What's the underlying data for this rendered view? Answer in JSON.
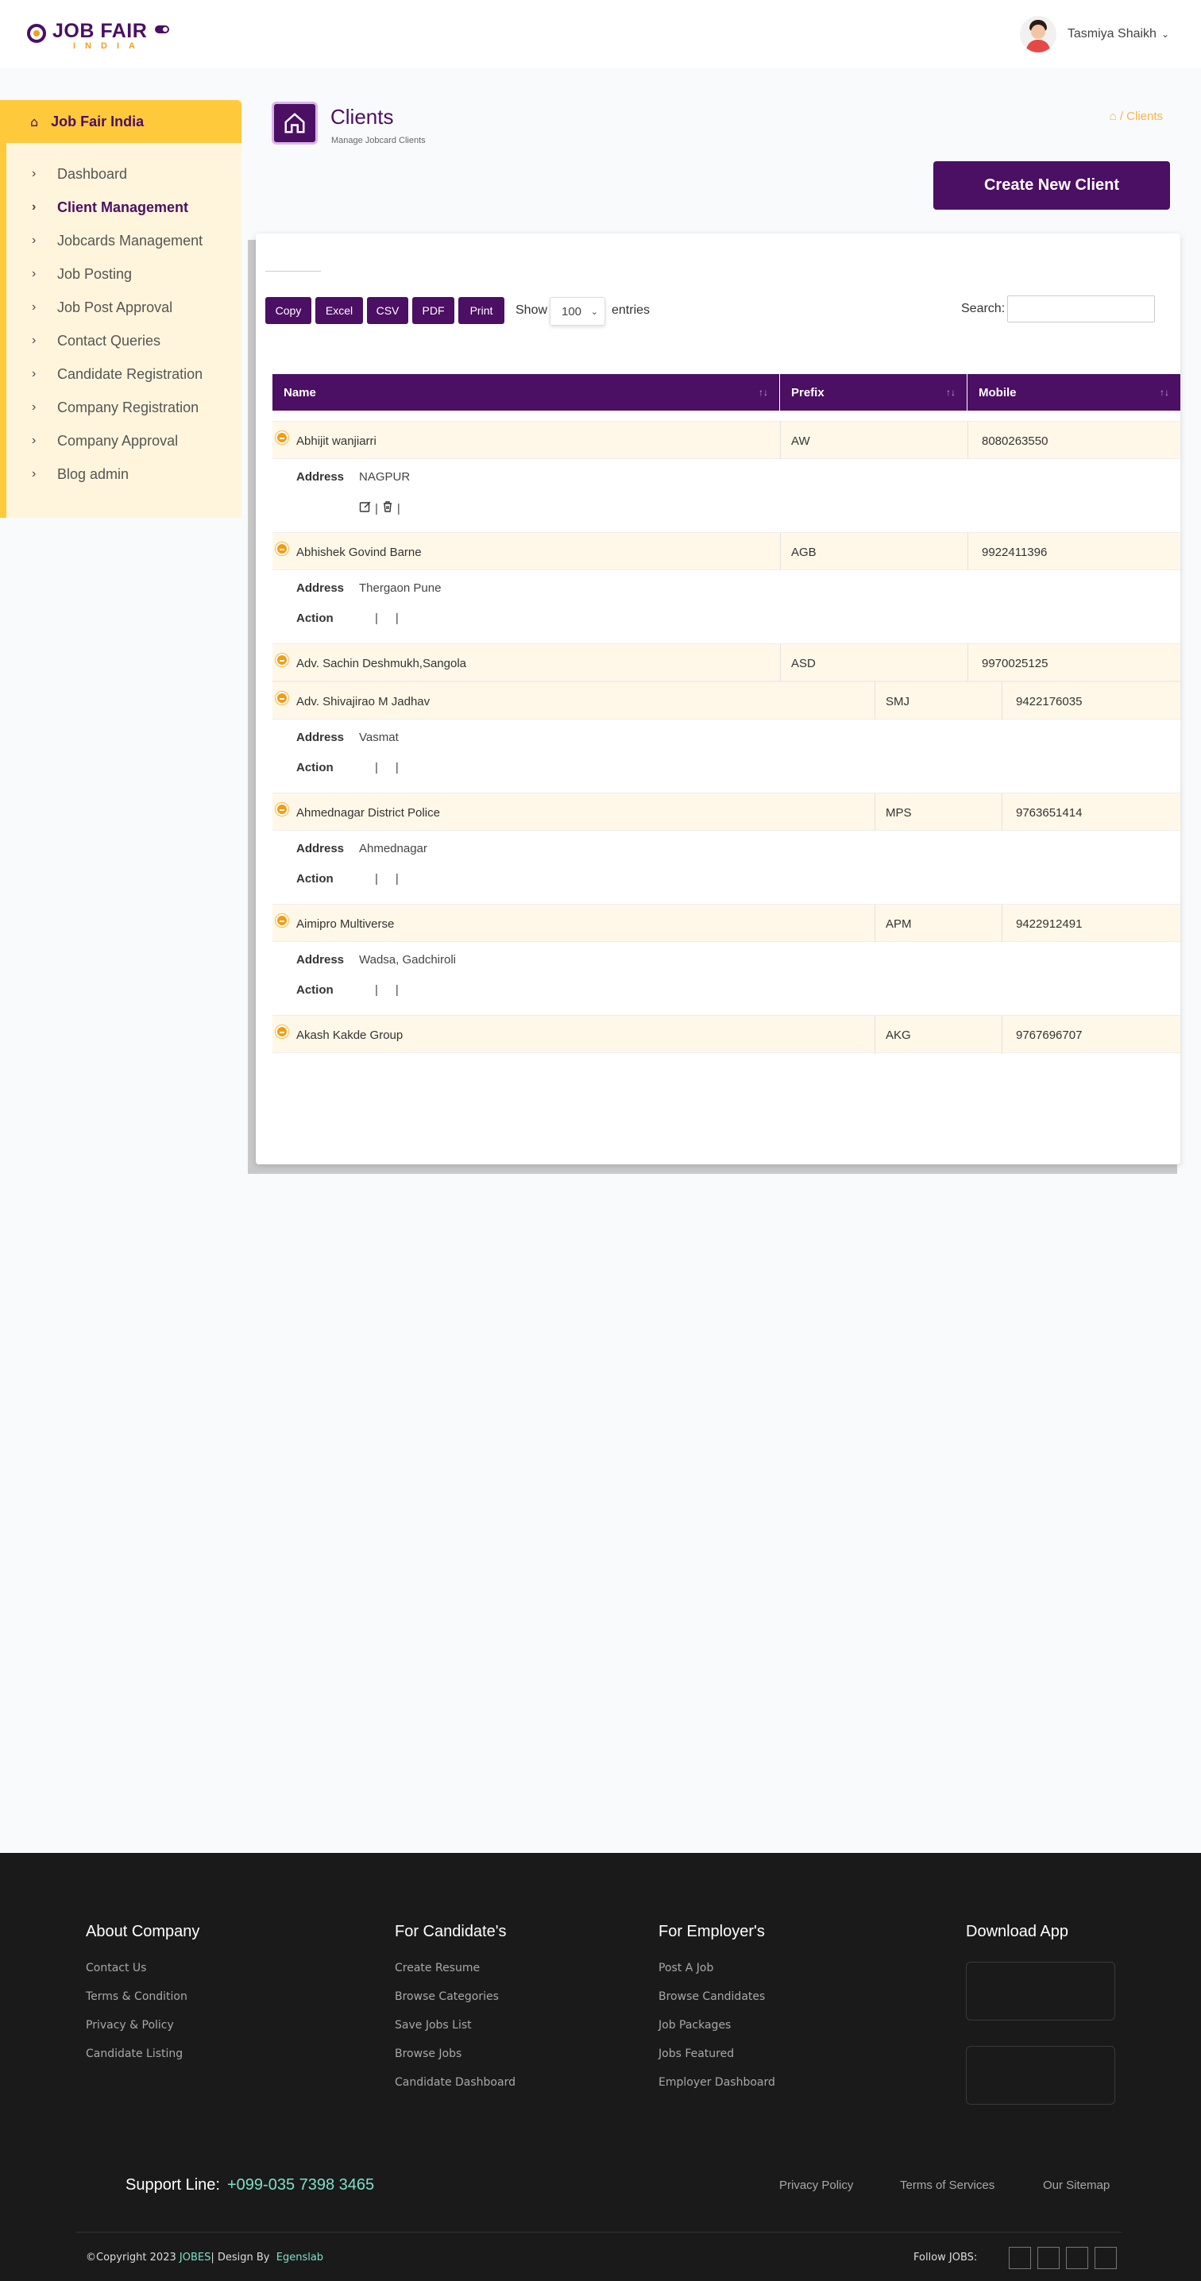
{
  "brand": {
    "title": "JOB FAIR",
    "subtitle": "INDIA"
  },
  "user": {
    "name": "Tasmiya Shaikh"
  },
  "sidebar": {
    "title": "Job Fair India",
    "items": [
      {
        "label": "Dashboard",
        "active": false
      },
      {
        "label": "Client Management",
        "active": true
      },
      {
        "label": "Jobcards Management",
        "active": false
      },
      {
        "label": "Job Posting",
        "active": false
      },
      {
        "label": "Job Post Approval",
        "active": false
      },
      {
        "label": "Contact Queries",
        "active": false
      },
      {
        "label": "Candidate Registration",
        "active": false
      },
      {
        "label": "Company Registration",
        "active": false
      },
      {
        "label": "Company Approval",
        "active": false
      },
      {
        "label": "Blog admin",
        "active": false
      }
    ]
  },
  "page": {
    "title": "Clients",
    "subtitle": "Manage Jobcard Clients",
    "breadcrumb": "/ Clients",
    "create_button": "Create New Client"
  },
  "table_controls": {
    "export_buttons": [
      "Copy",
      "Excel",
      "CSV",
      "PDF",
      "Print"
    ],
    "show_label": "Show",
    "page_size": "100",
    "entries_label": "entries",
    "search_label": "Search:",
    "search_value": ""
  },
  "table": {
    "columns": [
      "Name",
      "Prefix",
      "Mobile"
    ],
    "detail_labels": {
      "address": "Address",
      "action": "Action"
    },
    "rows": [
      {
        "name": "Abhijit wanjiarri",
        "prefix": "AW",
        "mobile": "8080263550",
        "address": "NAGPUR"
      },
      {
        "name": "Abhishek Govind Barne",
        "prefix": "AGB",
        "mobile": "9922411396",
        "address": "Thergaon Pune"
      },
      {
        "name": "Adv. Sachin Deshmukh,Sangola",
        "prefix": "ASD",
        "mobile": "9970025125",
        "address": ""
      },
      {
        "name": "Adv. Shivajirao M Jadhav",
        "prefix": "SMJ",
        "mobile": "9422176035",
        "address": "Vasmat"
      },
      {
        "name": "Ahmednagar District Police",
        "prefix": "MPS",
        "mobile": "9763651414",
        "address": "Ahmednagar"
      },
      {
        "name": "Aimipro Multiverse",
        "prefix": "APM",
        "mobile": "9422912491",
        "address": "Wadsa, Gadchiroli"
      },
      {
        "name": "Akash Kakde Group",
        "prefix": "AKG",
        "mobile": "9767696707",
        "address": ""
      }
    ],
    "action_sep": "|"
  },
  "footer": {
    "columns": [
      {
        "title": "About Company",
        "links": [
          "Contact Us",
          "Terms & Condition",
          "Privacy & Policy",
          "Candidate Listing"
        ]
      },
      {
        "title": "For Candidate's",
        "links": [
          "Create Resume",
          "Browse Categories",
          "Save Jobs List",
          "Browse Jobs",
          "Candidate Dashboard"
        ]
      },
      {
        "title": "For Employer's",
        "links": [
          "Post A Job",
          "Browse Candidates",
          "Job Packages",
          "Jobs Featured",
          "Employer Dashboard"
        ]
      },
      {
        "title": "Download App",
        "links": []
      }
    ],
    "support_label": "Support Line:",
    "support_number": "+099-035 7398 3465",
    "bottom_links": [
      "Privacy Policy",
      "Terms of Services",
      "Our Sitemap"
    ],
    "copyright_prefix": "©Copyright 2023",
    "copyright_brand": "JOBES",
    "copyright_mid": "| Design By",
    "copyright_designer": "Egenslab",
    "follow_label": "Follow JOBS:"
  },
  "colors": {
    "primary": "#4b0f63",
    "accent": "#ffc93c",
    "row_bg": "#fff8e8",
    "footer_bg": "#1a1a1a"
  }
}
